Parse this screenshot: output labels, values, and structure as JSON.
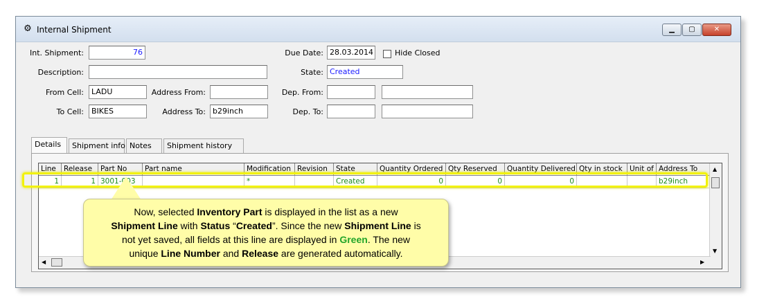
{
  "window": {
    "title": "Internal Shipment",
    "icon": "gear-icon",
    "buttons": {
      "min": "▁",
      "max": "▢",
      "close": "✕"
    }
  },
  "form": {
    "int_shipment": {
      "label": "Int. Shipment:",
      "value": "76"
    },
    "description": {
      "label": "Description:",
      "value": ""
    },
    "from_cell": {
      "label": "From Cell:",
      "value": "LADU"
    },
    "address_from": {
      "label": "Address From:",
      "value": ""
    },
    "to_cell": {
      "label": "To Cell:",
      "value": "BIKES"
    },
    "address_to": {
      "label": "Address To:",
      "value": "b29inch"
    },
    "due_date": {
      "label": "Due Date:",
      "value": "28.03.2014"
    },
    "hide_closed": {
      "label": "Hide Closed",
      "checked": false
    },
    "state": {
      "label": "State:",
      "value": "Created"
    },
    "dep_from": {
      "label": "Dep. From:",
      "value": "",
      "value2": ""
    },
    "dep_to": {
      "label": "Dep. To:",
      "value": "",
      "value2": ""
    }
  },
  "tabs": [
    "Details",
    "Shipment info",
    "Notes",
    "Shipment history"
  ],
  "grid": {
    "columns": [
      "Line",
      "Release",
      "Part No",
      "Part name",
      "Modification",
      "Revision",
      "State",
      "Quantity Ordered",
      "Qty Reserved",
      "Quantity Delivered",
      "Qty in stock",
      "Unit of",
      "Address To"
    ],
    "rows": [
      [
        "1",
        "1",
        "3001-003",
        "",
        "*",
        "",
        "Created",
        "0",
        "0",
        "0",
        "",
        "",
        "b29inch"
      ]
    ],
    "row_color": "#1a8a1a"
  },
  "callout": {
    "t1": "Now, selected ",
    "b1": "Inventory Part",
    "t2": " is displayed in the list as a new",
    "b2": "Shipment Line",
    "t3": " with ",
    "b3": "Status",
    "t4": " “",
    "b4": "Created",
    "t5": "”.  Since the new ",
    "b5": "Shipment Line",
    "t6": " is",
    "t7": "not yet saved, all fields at this line are displayed in ",
    "g1": "Green",
    "t8": ".  The new",
    "t9": "unique ",
    "b6": "Line Number",
    "t10": " and ",
    "b7": "Release",
    "t11": " are generated automatically."
  }
}
